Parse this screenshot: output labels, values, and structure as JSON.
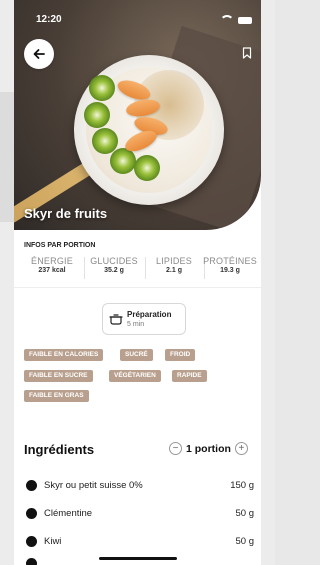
{
  "status": {
    "time": "12:20"
  },
  "recipe": {
    "title": "Skyr de fruits"
  },
  "info": {
    "header": "INFOS PAR PORTION",
    "nutrients": [
      {
        "label": "ÉNERGIE",
        "value": "237 kcal"
      },
      {
        "label": "GLUCIDES",
        "value": "35.2 g"
      },
      {
        "label": "LIPIDES",
        "value": "2.1 g"
      },
      {
        "label": "PROTÉINES",
        "value": "19.3 g"
      }
    ]
  },
  "preparation": {
    "label": "Préparation",
    "time": "5 min"
  },
  "tags": [
    "FAIBLE EN CALORIES",
    "SUCRÉ",
    "FROID",
    "FAIBLE EN SUCRE",
    "VÉGÉTARIEN",
    "RAPIDE",
    "FAIBLE EN GRAS"
  ],
  "ingredients": {
    "title": "Ingrédients",
    "portion_label": "1 portion",
    "minus": "−",
    "plus": "+",
    "items": [
      {
        "name": "Skyr ou petit suisse 0%",
        "qty": "150 g"
      },
      {
        "name": "Clémentine",
        "qty": "50 g"
      },
      {
        "name": "Kiwi",
        "qty": "50 g"
      }
    ]
  },
  "colors": {
    "tag_bg": "#b9a08e",
    "accent_dark": "#111111"
  },
  "icons": {
    "back": "arrow-left-icon",
    "bookmark": "bookmark-icon",
    "prep": "cooking-pot-icon"
  }
}
